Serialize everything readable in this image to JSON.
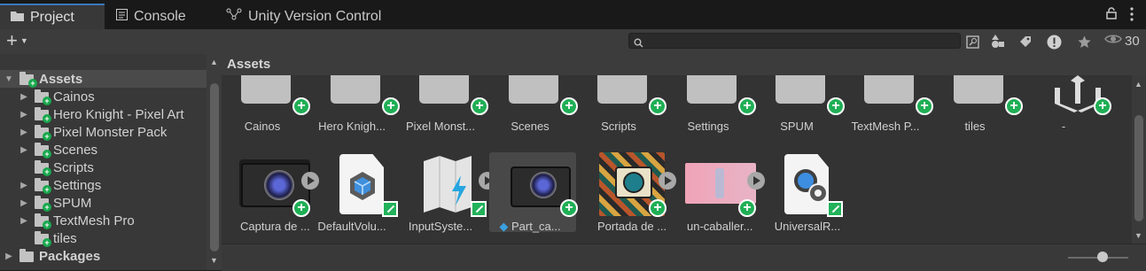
{
  "tabs": [
    {
      "label": "Project",
      "icon": "folder-icon",
      "active": true
    },
    {
      "label": "Console",
      "icon": "console-icon",
      "active": false
    },
    {
      "label": "Unity Version Control",
      "icon": "branch-icon",
      "active": false
    }
  ],
  "toolbar": {
    "add_label": "+",
    "search_value": "",
    "hidden_count": "30",
    "icons": [
      "search-icon",
      "search-by-type-icon",
      "label-icon",
      "log-filter-icon",
      "favorite-icon",
      "eye-icon"
    ]
  },
  "tree": {
    "items": [
      {
        "label": "Assets",
        "selected": true
      },
      {
        "label": "Cainos"
      },
      {
        "label": "Hero Knight - Pixel Art"
      },
      {
        "label": "Pixel Monster Pack"
      },
      {
        "label": "Scenes"
      },
      {
        "label": "Scripts"
      },
      {
        "label": "Settings"
      },
      {
        "label": "SPUM"
      },
      {
        "label": "TextMesh Pro"
      },
      {
        "label": "tiles"
      },
      {
        "label": "Packages"
      }
    ]
  },
  "grid": {
    "title": "Assets",
    "folders": [
      "Cainos",
      "Hero Knigh...",
      "Pixel Monst...",
      "Scenes",
      "Scripts",
      "Settings",
      "SPUM",
      "TextMesh P...",
      "tiles",
      "-"
    ],
    "assets": [
      {
        "label": "Captura de ..."
      },
      {
        "label": "DefaultVolu..."
      },
      {
        "label": "InputSyste..."
      },
      {
        "label": "Part_ca..."
      },
      {
        "label": "Portada de ..."
      },
      {
        "label": "un-caballer..."
      },
      {
        "label": "UniversalR..."
      }
    ]
  },
  "colors": {
    "accent": "#3a79bb",
    "badge_green": "#1faf55",
    "panel": "#383838",
    "grid_bg": "#333333"
  }
}
